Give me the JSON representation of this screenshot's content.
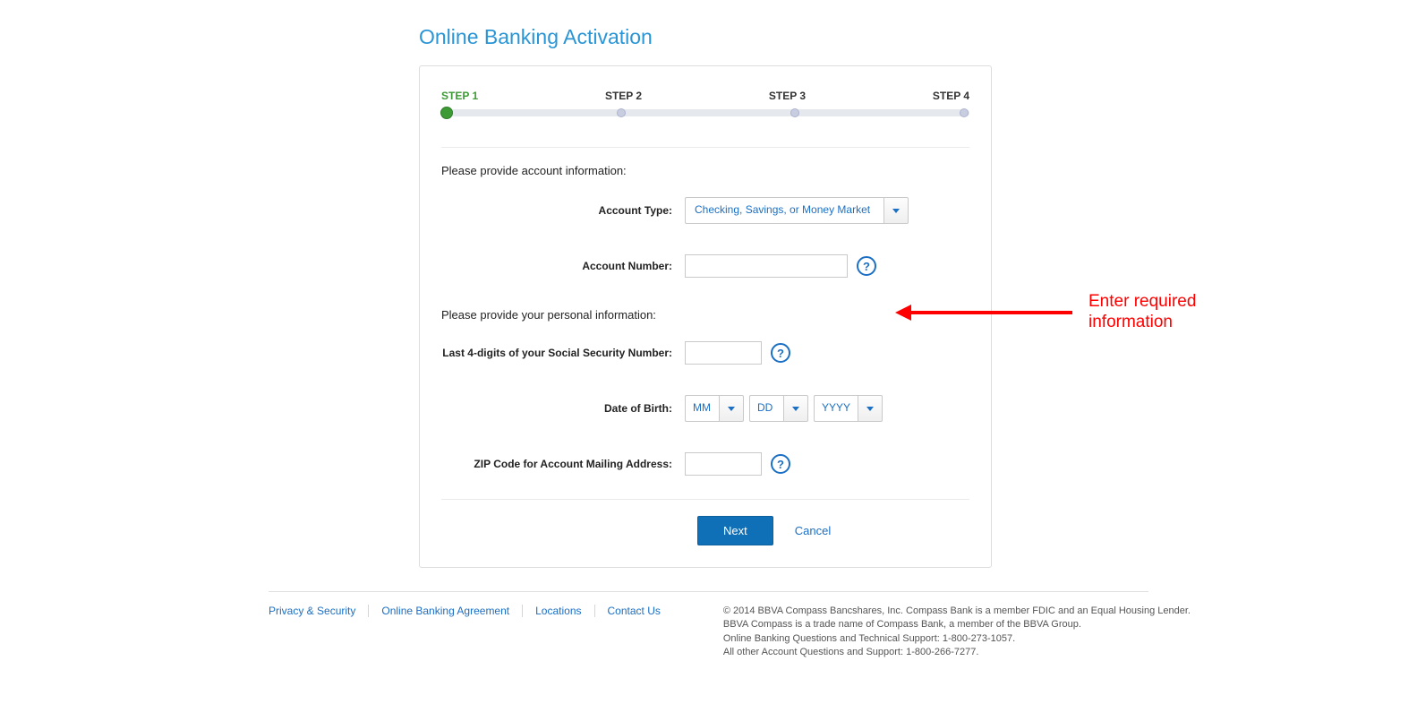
{
  "page": {
    "title": "Online Banking Activation"
  },
  "stepper": {
    "steps": [
      "STEP 1",
      "STEP 2",
      "STEP 3",
      "STEP 4"
    ],
    "activeIndex": 0
  },
  "sections": {
    "account_intro": "Please provide account information:",
    "personal_intro": "Please provide your personal information:"
  },
  "form": {
    "account_type_label": "Account Type:",
    "account_type_value": "Checking, Savings, or Money Market",
    "account_number_label": "Account Number:",
    "ssn_label": "Last 4-digits of your Social Security Number:",
    "dob_label": "Date of Birth:",
    "dob_mm": "MM",
    "dob_dd": "DD",
    "dob_yyyy": "YYYY",
    "zip_label": "ZIP Code for Account Mailing Address:",
    "help_icon_glyph": "?"
  },
  "actions": {
    "next_label": "Next",
    "cancel_label": "Cancel"
  },
  "footer": {
    "links": [
      "Privacy & Security",
      "Online Banking Agreement",
      "Locations",
      "Contact Us"
    ],
    "line1": "© 2014 BBVA Compass Bancshares, Inc. Compass Bank is a member FDIC and an Equal Housing Lender.",
    "line2": "BBVA Compass is a trade name of Compass Bank, a member of the BBVA Group.",
    "line3": "Online Banking Questions and Technical Support: 1-800-273-1057.",
    "line4": "All other Account Questions and Support: 1-800-266-7277."
  },
  "annotation": {
    "text_line1": "Enter required",
    "text_line2": "information"
  }
}
